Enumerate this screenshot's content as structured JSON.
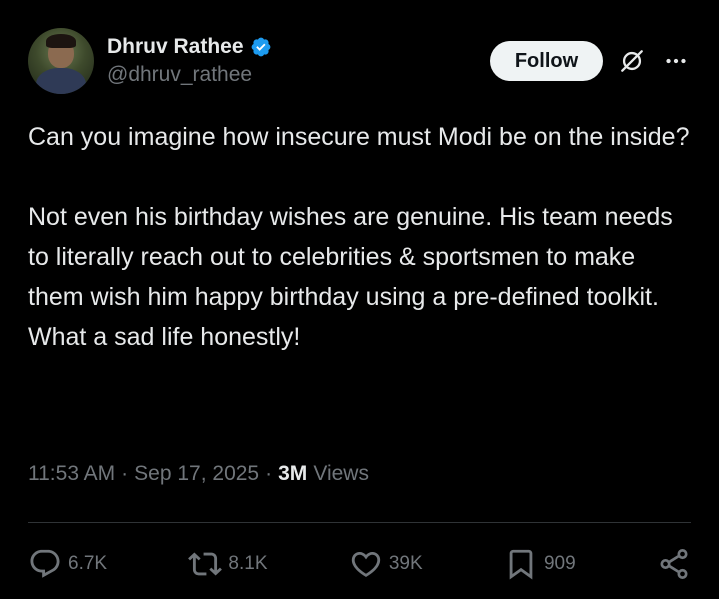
{
  "user": {
    "display_name": "Dhruv Rathee",
    "handle": "@dhruv_rathee",
    "verified": true
  },
  "header": {
    "follow_label": "Follow",
    "icons": [
      "grok-icon",
      "more-icon"
    ]
  },
  "tweet": {
    "paragraphs": [
      "Can you imagine how insecure must Modi be on the inside?",
      "Not even his birthday wishes are genuine. His team needs to literally reach out to celebrities & sportsmen to make them wish him happy birthday using a pre-defined toolkit. What a sad life honestly!"
    ]
  },
  "meta": {
    "time": "11:53 AM",
    "date": "Sep 17, 2025",
    "views_count": "3M",
    "views_label": "Views"
  },
  "actions": {
    "replies": "6.7K",
    "reposts": "8.1K",
    "likes": "39K",
    "bookmarks": "909"
  },
  "colors": {
    "background": "#000000",
    "text": "#e7e9ea",
    "secondary": "#71767b",
    "verified": "#1d9bf0",
    "follow_bg": "#eff3f4",
    "divider": "#2f3336"
  }
}
